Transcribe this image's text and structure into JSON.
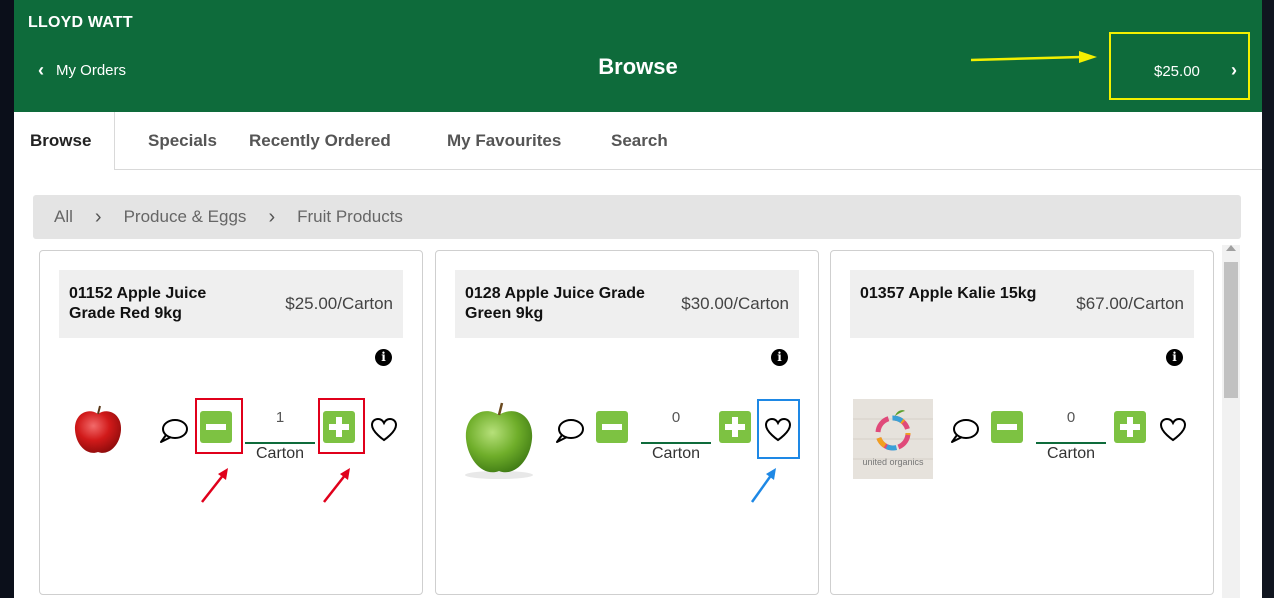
{
  "header": {
    "customer_name": "LLOYD WATT",
    "back_label": "My Orders",
    "title": "Browse",
    "cart_total": "$25.00"
  },
  "tabs": [
    {
      "label": "Browse",
      "active": true
    },
    {
      "label": "Specials",
      "active": false
    },
    {
      "label": "Recently Ordered",
      "active": false
    },
    {
      "label": "My Favourites",
      "active": false
    },
    {
      "label": "Search",
      "active": false
    }
  ],
  "breadcrumb": [
    "All",
    "Produce & Eggs",
    "Fruit Products"
  ],
  "products": [
    {
      "name": "01152 Apple Juice Grade Red 9kg",
      "price": "$25.00/Carton",
      "quantity": "1",
      "unit": "Carton",
      "image": "red-apple"
    },
    {
      "name": "0128 Apple Juice Grade Green 9kg",
      "price": "$30.00/Carton",
      "quantity": "0",
      "unit": "Carton",
      "image": "green-apple"
    },
    {
      "name": "01357 Apple Kalie 15kg",
      "price": "$67.00/Carton",
      "quantity": "0",
      "unit": "Carton",
      "image": "united-organics-logo",
      "logo_text": "united organics"
    }
  ],
  "icons": {
    "info": "info-icon",
    "comment": "speech-bubble-icon",
    "decrease": "minus-icon",
    "increase": "plus-icon",
    "favourite": "heart-icon"
  },
  "colors": {
    "header_bg": "#0e6b3b",
    "qty_button": "#7dc242",
    "callout_yellow": "#f3f000",
    "callout_red": "#e0001b",
    "callout_blue": "#1e88e5"
  }
}
